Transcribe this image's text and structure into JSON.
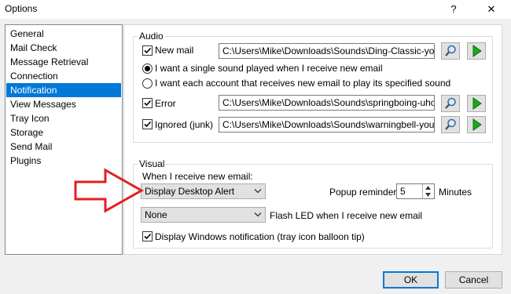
{
  "window": {
    "title": "Options",
    "help_glyph": "?",
    "close_glyph": "✕"
  },
  "nav": {
    "items": [
      {
        "label": "General"
      },
      {
        "label": "Mail Check"
      },
      {
        "label": "Message Retrieval"
      },
      {
        "label": "Connection"
      },
      {
        "label": "Notification",
        "selected": true
      },
      {
        "label": "View Messages"
      },
      {
        "label": "Tray Icon"
      },
      {
        "label": "Storage"
      },
      {
        "label": "Send Mail"
      },
      {
        "label": "Plugins"
      }
    ]
  },
  "audio": {
    "group_label": "Audio",
    "new_mail": {
      "label": "New mail",
      "checked": true,
      "path": "C:\\Users\\Mike\\Downloads\\Sounds\\Ding-Classic-youvego"
    },
    "radio_single": {
      "label": "I want a single sound played when I receive new email",
      "selected": true
    },
    "radio_each": {
      "label": "I want each account that receives new email to play its specified sound",
      "selected": false
    },
    "error": {
      "label": "Error",
      "checked": true,
      "path": "C:\\Users\\Mike\\Downloads\\Sounds\\springboing-uhoh.wav"
    },
    "ignored": {
      "label": "Ignored (junk)",
      "checked": true,
      "path": "C:\\Users\\Mike\\Downloads\\Sounds\\warningbell-youvegot"
    }
  },
  "visual": {
    "group_label": "Visual",
    "when_label": "When I receive new email:",
    "alert_select": "Display Desktop Alert",
    "popup_label": "Popup reminder:",
    "popup_value": "5",
    "popup_unit": "Minutes",
    "led_select": "None",
    "led_label": "Flash LED when I receive new email",
    "windows_notification": {
      "label": "Display Windows notification (tray icon balloon tip)",
      "checked": true
    }
  },
  "footer": {
    "ok": "OK",
    "cancel": "Cancel"
  },
  "colors": {
    "accent": "#0078d7",
    "play_green": "#1aa81a",
    "arrow_red": "#e02020"
  },
  "icons": {
    "browse": "magnifier-icon",
    "play": "play-icon",
    "annotation": "red-arrow-annotation"
  }
}
